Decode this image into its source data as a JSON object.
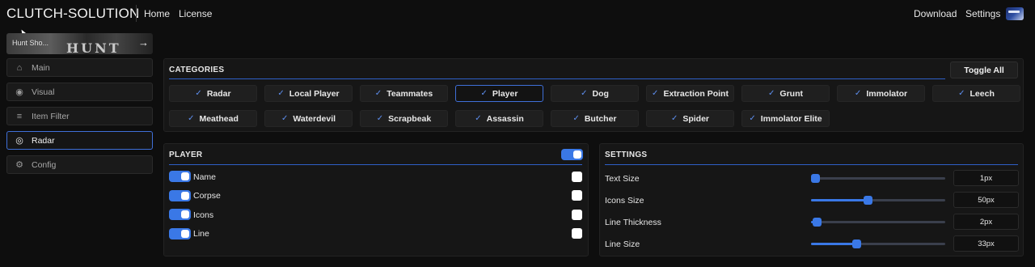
{
  "nav": {
    "brand": "CLUTCH-SOLUTION",
    "links": [
      "Home",
      "License"
    ],
    "right_links": [
      "Download",
      "Settings"
    ],
    "flag_icon": "flag-icon"
  },
  "sidebar": {
    "game_card": {
      "name": "Hunt Sho...",
      "logo": "HUNT",
      "arrow": "→"
    },
    "items": [
      {
        "label": "Main",
        "icon": "home-icon",
        "glyph": "⌂",
        "active": false
      },
      {
        "label": "Visual",
        "icon": "eye-icon",
        "glyph": "◉",
        "active": false
      },
      {
        "label": "Item Filter",
        "icon": "list-icon",
        "glyph": "≡",
        "active": false
      },
      {
        "label": "Radar",
        "icon": "radar-icon",
        "glyph": "◎",
        "active": true
      },
      {
        "label": "Config",
        "icon": "gears-icon",
        "glyph": "⚙",
        "active": false
      }
    ]
  },
  "categories": {
    "title": "CATEGORIES",
    "toggle_all": "Toggle All",
    "check": "✓",
    "row1": [
      "Radar",
      "Local Player",
      "Teammates",
      "Player",
      "Dog",
      "Extraction Point",
      "Grunt",
      "Immolator",
      "Leech"
    ],
    "row2": [
      "Meathead",
      "Waterdevil",
      "Scrapbeak",
      "Assassin",
      "Butcher",
      "Spider",
      "Immolator Elite"
    ],
    "selected": "Player"
  },
  "player": {
    "title": "PLAYER",
    "options": [
      {
        "label": "Name",
        "enabled": true
      },
      {
        "label": "Corpse",
        "enabled": true
      },
      {
        "label": "Icons",
        "enabled": true
      },
      {
        "label": "Line",
        "enabled": true
      }
    ]
  },
  "settings": {
    "title": "SETTINGS",
    "items": [
      {
        "label": "Text Size",
        "value": "1px",
        "fraction": 0.03
      },
      {
        "label": "Icons Size",
        "value": "50px",
        "fraction": 0.42
      },
      {
        "label": "Line Thickness",
        "value": "2px",
        "fraction": 0.04
      },
      {
        "label": "Line Size",
        "value": "33px",
        "fraction": 0.34
      }
    ]
  },
  "colors": {
    "accent": "#3a78e6",
    "background": "#0e0e0e",
    "panel": "#161616"
  }
}
